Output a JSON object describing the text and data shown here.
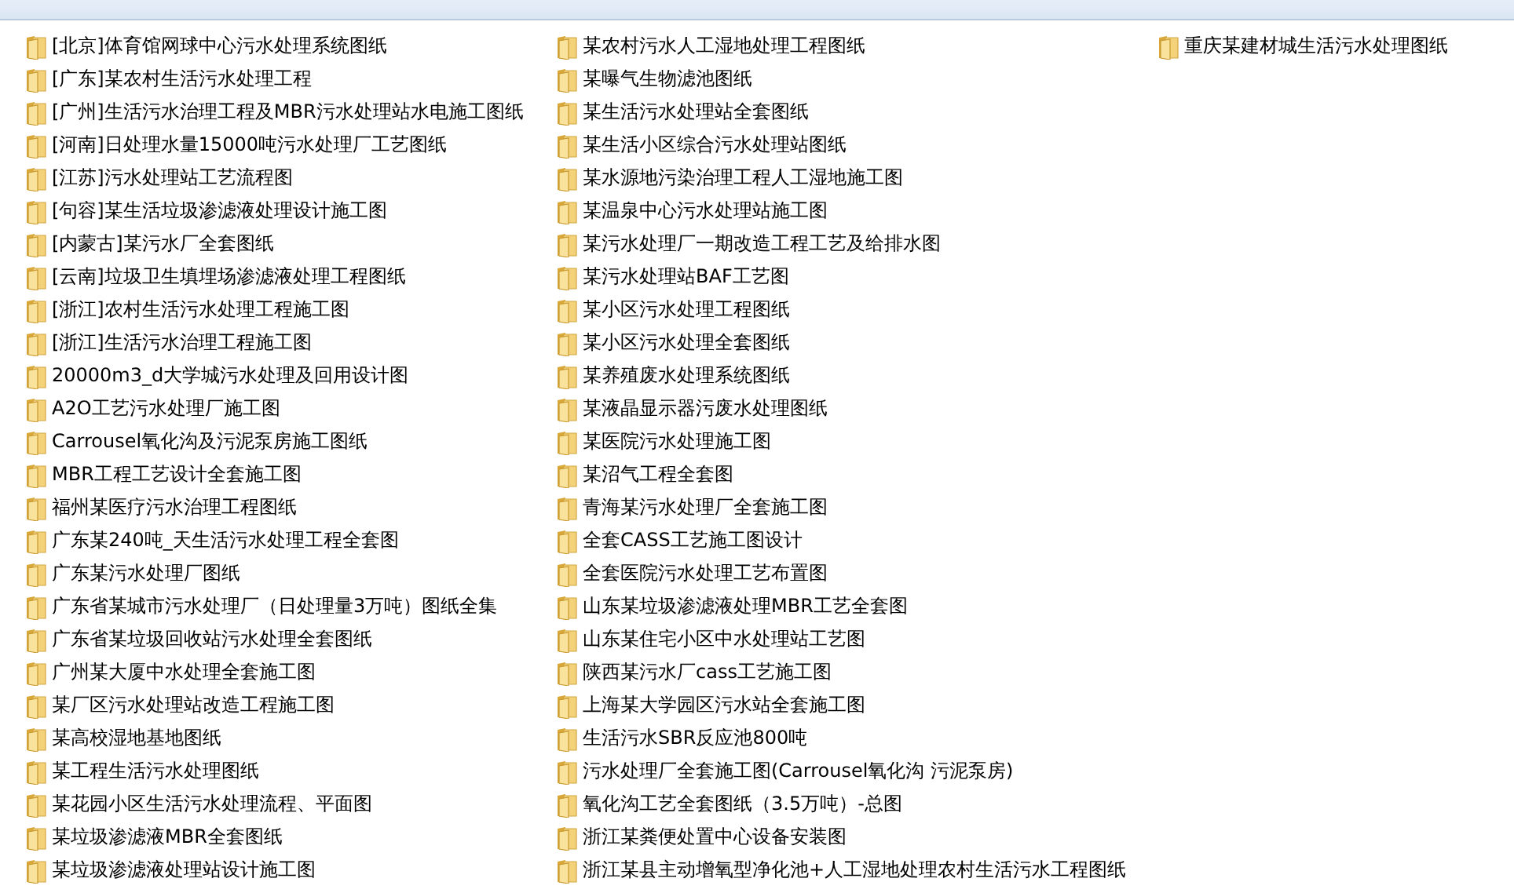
{
  "folders": [
    {
      "name": "[北京]体育馆网球中心污水处理系统图纸"
    },
    {
      "name": "[广东]某农村生活污水处理工程"
    },
    {
      "name": "[广州]生活污水治理工程及MBR污水处理站水电施工图纸"
    },
    {
      "name": "[河南]日处理水量15000吨污水处理厂工艺图纸"
    },
    {
      "name": "[江苏]污水处理站工艺流程图"
    },
    {
      "name": "[句容]某生活垃圾渗滤液处理设计施工图"
    },
    {
      "name": "[内蒙古]某污水厂全套图纸"
    },
    {
      "name": "[云南]垃圾卫生填埋场渗滤液处理工程图纸"
    },
    {
      "name": "[浙江]农村生活污水处理工程施工图"
    },
    {
      "name": "[浙江]生活污水治理工程施工图"
    },
    {
      "name": "20000m3_d大学城污水处理及回用设计图"
    },
    {
      "name": "A2O工艺污水处理厂施工图"
    },
    {
      "name": "Carrousel氧化沟及污泥泵房施工图纸"
    },
    {
      "name": "MBR工程工艺设计全套施工图"
    },
    {
      "name": "福州某医疗污水治理工程图纸"
    },
    {
      "name": "广东某240吨_天生活污水处理工程全套图"
    },
    {
      "name": "广东某污水处理厂图纸"
    },
    {
      "name": "广东省某城市污水处理厂（日处理量3万吨）图纸全集"
    },
    {
      "name": "广东省某垃圾回收站污水处理全套图纸"
    },
    {
      "name": "广州某大厦中水处理全套施工图"
    },
    {
      "name": "某厂区污水处理站改造工程施工图"
    },
    {
      "name": "某高校湿地基地图纸"
    },
    {
      "name": "某工程生活污水处理图纸"
    },
    {
      "name": "某花园小区生活污水处理流程、平面图"
    },
    {
      "name": "某垃圾渗滤液MBR全套图纸"
    },
    {
      "name": "某垃圾渗滤液处理站设计施工图"
    },
    {
      "name": "某农村污水人工湿地处理工程图纸"
    },
    {
      "name": "某曝气生物滤池图纸"
    },
    {
      "name": "某生活污水处理站全套图纸"
    },
    {
      "name": "某生活小区综合污水处理站图纸"
    },
    {
      "name": "某水源地污染治理工程人工湿地施工图"
    },
    {
      "name": "某温泉中心污水处理站施工图"
    },
    {
      "name": "某污水处理厂一期改造工程工艺及给排水图"
    },
    {
      "name": "某污水处理站BAF工艺图"
    },
    {
      "name": "某小区污水处理工程图纸"
    },
    {
      "name": "某小区污水处理全套图纸"
    },
    {
      "name": "某养殖废水处理系统图纸"
    },
    {
      "name": "某液晶显示器污废水处理图纸"
    },
    {
      "name": "某医院污水处理施工图"
    },
    {
      "name": "某沼气工程全套图"
    },
    {
      "name": "青海某污水处理厂全套施工图"
    },
    {
      "name": "全套CASS工艺施工图设计"
    },
    {
      "name": "全套医院污水处理工艺布置图"
    },
    {
      "name": "山东某垃圾渗滤液处理MBR工艺全套图"
    },
    {
      "name": "山东某住宅小区中水处理站工艺图"
    },
    {
      "name": "陕西某污水厂cass工艺施工图"
    },
    {
      "name": "上海某大学园区污水站全套施工图"
    },
    {
      "name": "生活污水SBR反应池800吨"
    },
    {
      "name": "污水处理厂全套施工图(Carrousel氧化沟 污泥泵房)"
    },
    {
      "name": "氧化沟工艺全套图纸（3.5万吨）-总图"
    },
    {
      "name": "浙江某粪便处置中心设备安装图"
    },
    {
      "name": "浙江某县主动增氧型净化池+人工湿地处理农村生活污水工程图纸"
    },
    {
      "name": "重庆某建材城生活污水处理图纸"
    }
  ]
}
